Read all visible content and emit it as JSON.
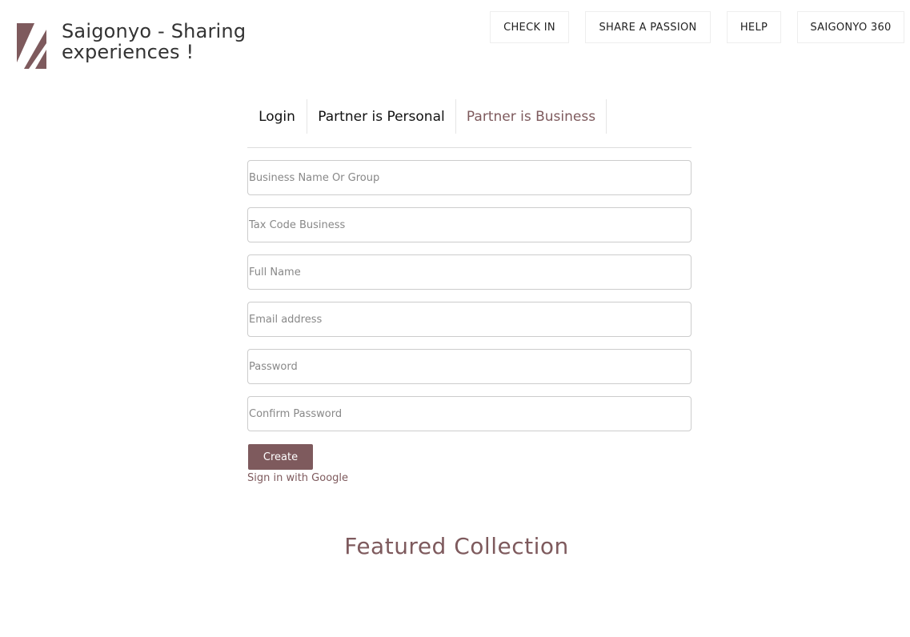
{
  "brand": {
    "title": "Saigonyo - Sharing experiences !",
    "logo_icon": "saigonyo-s-logo-icon",
    "accent_color": "#7e5a5d"
  },
  "nav": {
    "items": [
      {
        "label": "CHECK IN"
      },
      {
        "label": "SHARE A PASSION"
      },
      {
        "label": "HELP"
      },
      {
        "label": "SAIGONYO 360"
      }
    ]
  },
  "tabs": [
    {
      "label": "Login",
      "active": false
    },
    {
      "label": "Partner is Personal",
      "active": false
    },
    {
      "label": "Partner is Business",
      "active": true
    }
  ],
  "form": {
    "fields": [
      {
        "placeholder": "Business Name Or Group",
        "value": ""
      },
      {
        "placeholder": "Tax Code Business",
        "value": ""
      },
      {
        "placeholder": "Full Name",
        "value": ""
      },
      {
        "placeholder": "Email address",
        "value": ""
      },
      {
        "placeholder": "Password",
        "value": ""
      },
      {
        "placeholder": "Confirm Password",
        "value": ""
      }
    ],
    "submit_label": "Create",
    "google_link": "Sign in with Google"
  },
  "featured": {
    "title": "Featured Collection"
  }
}
